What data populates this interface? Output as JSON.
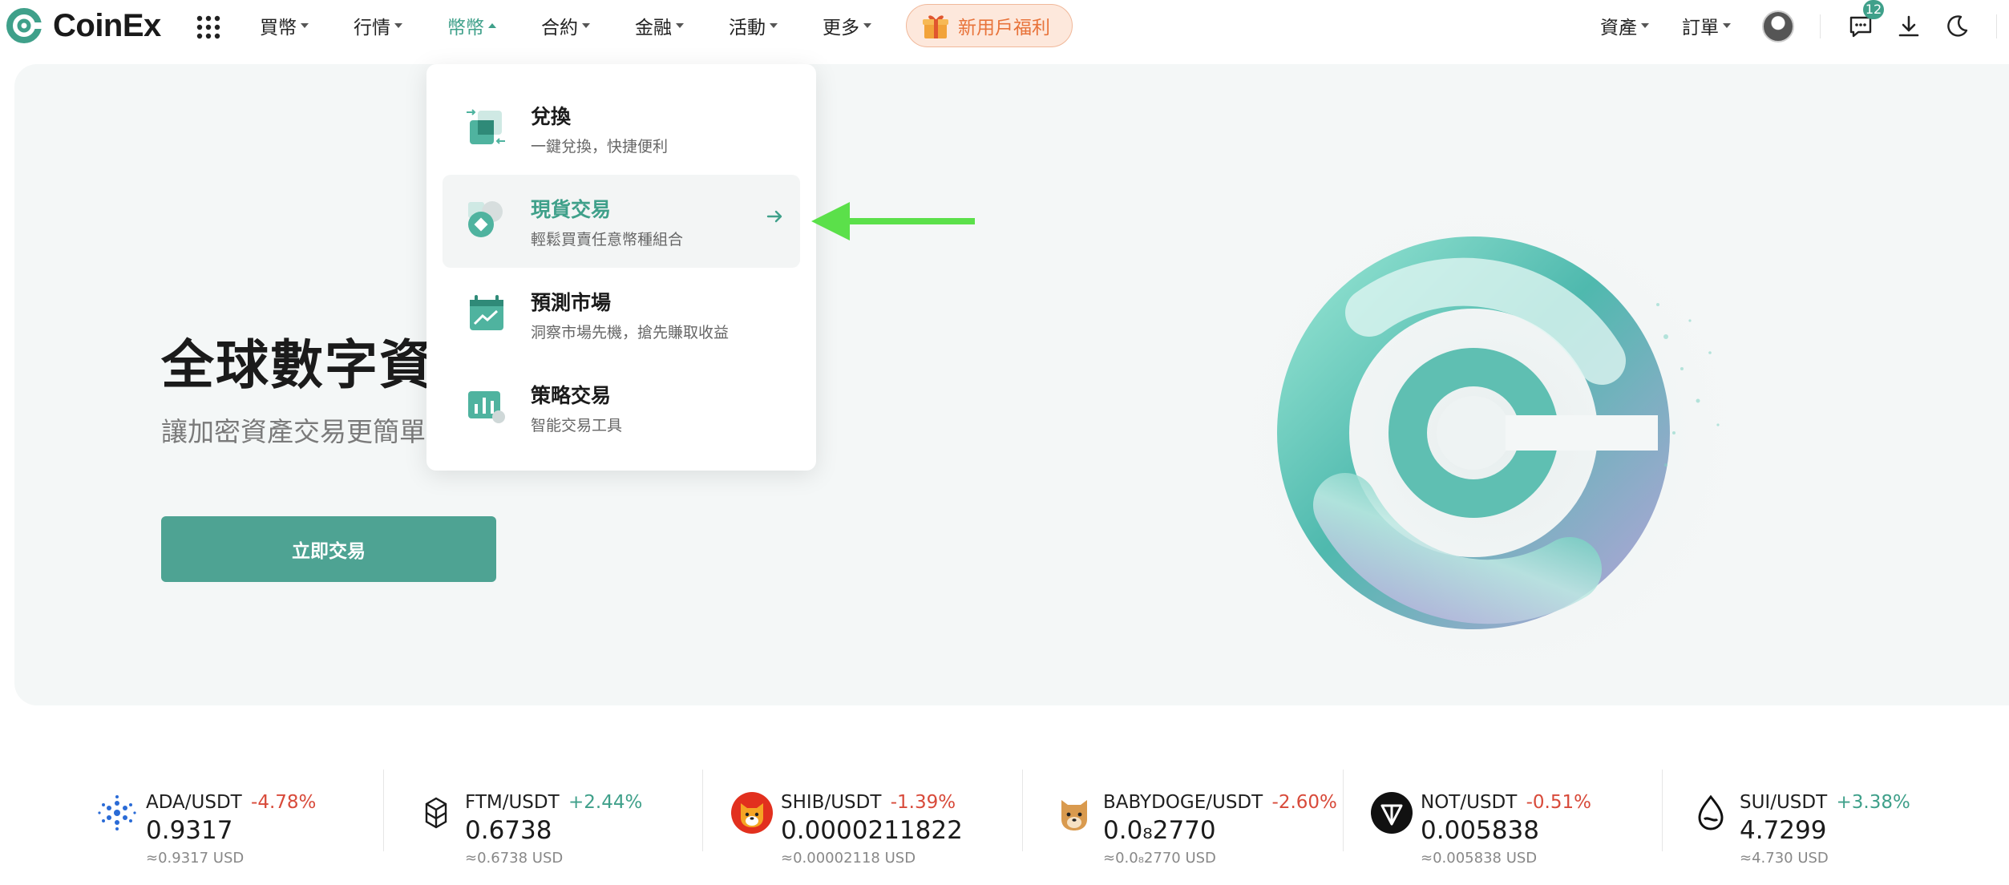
{
  "brand": {
    "name": "CoinEx",
    "accent": "#3fa08a"
  },
  "nav": {
    "items": [
      {
        "label": "買幣",
        "active": false
      },
      {
        "label": "行情",
        "active": false
      },
      {
        "label": "幣幣",
        "active": true
      },
      {
        "label": "合約",
        "active": false
      },
      {
        "label": "金融",
        "active": false
      },
      {
        "label": "活動",
        "active": false
      },
      {
        "label": "更多",
        "active": false
      }
    ],
    "promo_label": "新用戶福利",
    "right": {
      "assets": "資產",
      "orders": "訂單",
      "message_count": "12"
    }
  },
  "hero": {
    "title": "全球數字資產",
    "subtitle": "讓加密資產交易更簡單",
    "cta": "立即交易"
  },
  "dropdown": {
    "items": [
      {
        "title": "兌換",
        "desc": "一鍵兌換，快捷便利",
        "icon": "exchange-icon"
      },
      {
        "title": "現貨交易",
        "desc": "輕鬆買賣任意幣種組合",
        "icon": "spot-icon",
        "highlighted": true
      },
      {
        "title": "預測市場",
        "desc": "洞察市場先機，搶先賺取收益",
        "icon": "prediction-icon"
      },
      {
        "title": "策略交易",
        "desc": "智能交易工具",
        "icon": "strategy-icon"
      }
    ]
  },
  "ticker": [
    {
      "pair": "ADA/USDT",
      "change": "-4.78%",
      "dir": "neg",
      "price": "0.9317",
      "usd": "≈0.9317 USD",
      "icon": "ada-icon"
    },
    {
      "pair": "FTM/USDT",
      "change": "+2.44%",
      "dir": "pos",
      "price": "0.6738",
      "usd": "≈0.6738 USD",
      "icon": "ftm-icon"
    },
    {
      "pair": "SHIB/USDT",
      "change": "-1.39%",
      "dir": "neg",
      "price": "0.0000211822",
      "usd": "≈0.00002118 USD",
      "icon": "shib-icon"
    },
    {
      "pair": "BABYDOGE/USDT",
      "change": "-2.60%",
      "dir": "neg",
      "price": "0.0₈2770",
      "usd": "≈0.0₈2770 USD",
      "icon": "babydoge-icon"
    },
    {
      "pair": "NOT/USDT",
      "change": "-0.51%",
      "dir": "neg",
      "price": "0.005838",
      "usd": "≈0.005838 USD",
      "icon": "not-icon"
    },
    {
      "pair": "SUI/USDT",
      "change": "+3.38%",
      "dir": "pos",
      "price": "4.7299",
      "usd": "≈4.730 USD",
      "icon": "sui-icon"
    }
  ]
}
